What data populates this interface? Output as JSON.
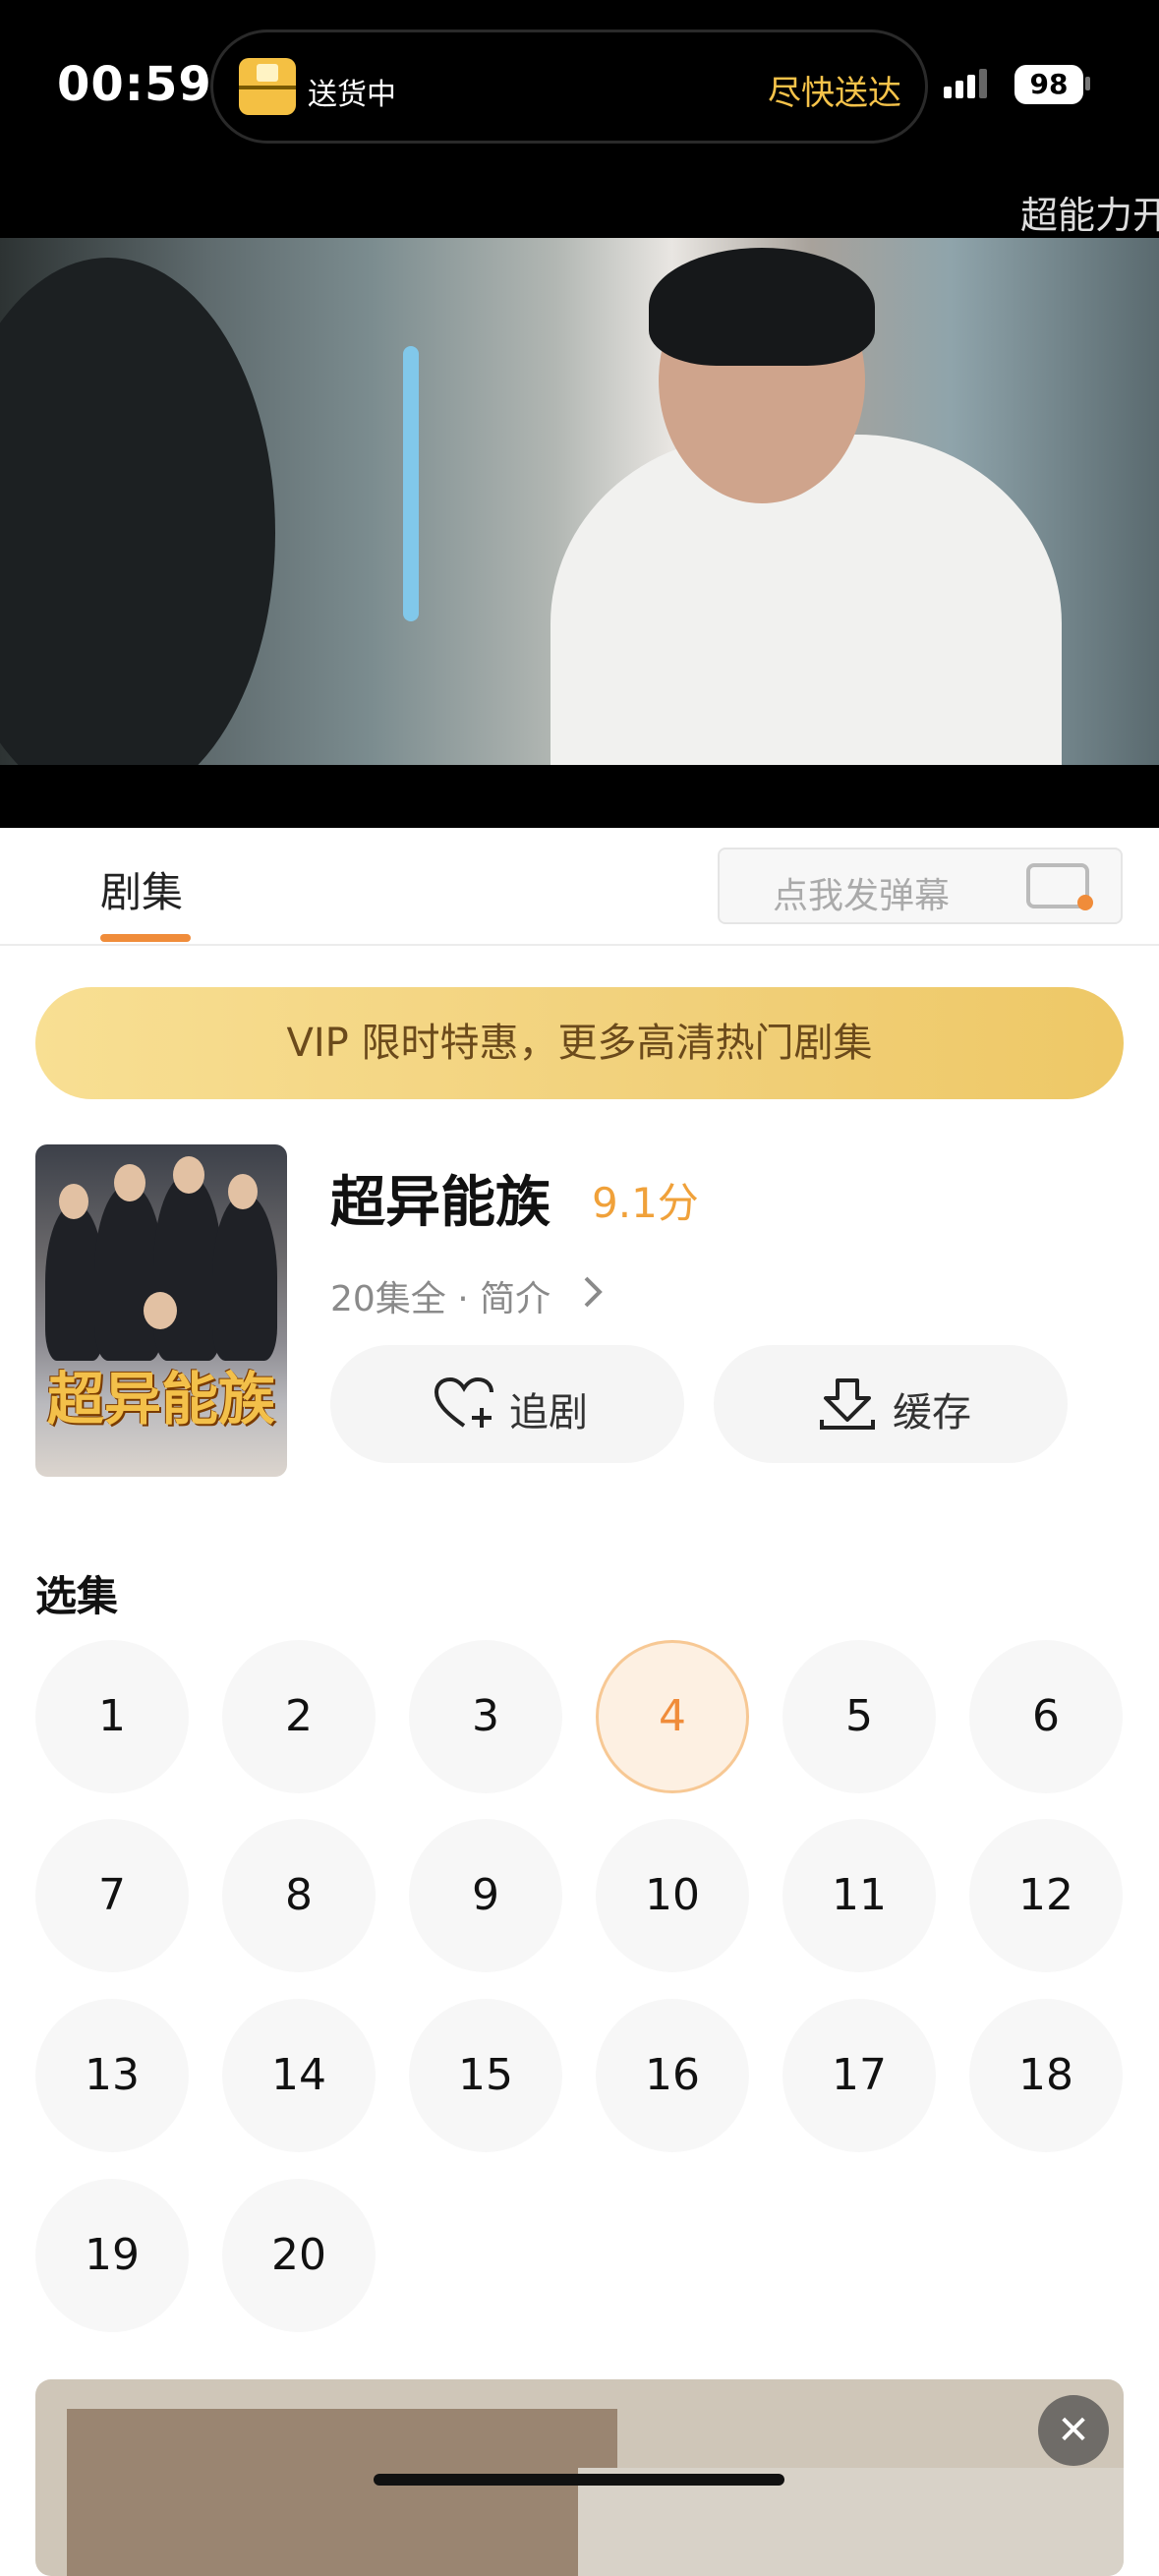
{
  "status_bar": {
    "time": "00:59",
    "island_left": "送货中",
    "island_right": "尽快送达",
    "battery": "98"
  },
  "marquee": "超能力开",
  "tabs": {
    "active": "剧集",
    "danmu_placeholder": "点我发弹幕"
  },
  "vip_banner": "VIP 限时特惠，更多高清热门剧集",
  "show": {
    "poster_title": "超异能族",
    "title": "超异能族",
    "score": "9.1分",
    "meta": "20集全 · 简介",
    "follow_label": "追剧",
    "cache_label": "缓存"
  },
  "episodes": {
    "title": "选集",
    "items": [
      "1",
      "2",
      "3",
      "4",
      "5",
      "6",
      "7",
      "8",
      "9",
      "10",
      "11",
      "12",
      "13",
      "14",
      "15",
      "16",
      "17",
      "18",
      "19",
      "20"
    ],
    "selected": "4"
  },
  "colors": {
    "accent": "#f08c3a",
    "score": "#f0a13a",
    "vip_text": "#6b4a1b"
  }
}
